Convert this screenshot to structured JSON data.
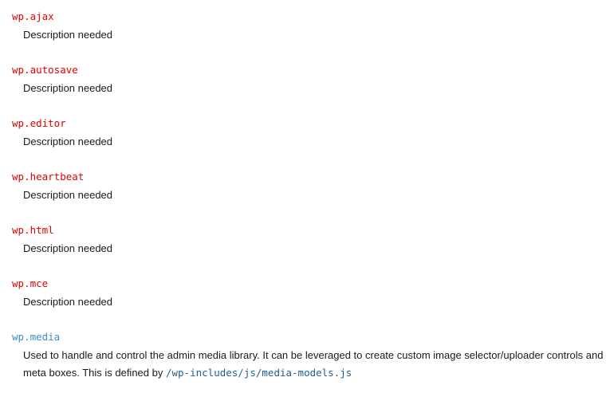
{
  "entries": [
    {
      "term": "wp.ajax",
      "description": "Description needed"
    },
    {
      "term": "wp.autosave",
      "description": "Description needed"
    },
    {
      "term": "wp.editor",
      "description": "Description needed"
    },
    {
      "term": "wp.heartbeat",
      "description": "Description needed"
    },
    {
      "term": "wp.html",
      "description": "Description needed"
    },
    {
      "term": "wp.mce",
      "description": "Description needed"
    },
    {
      "term": "wp.media",
      "description": "Used to handle and control the admin media library. It can be leveraged to create custom image selector/uploader controls and meta boxes. This is defined by",
      "path": "/wp-includes/js/media-models.js"
    }
  ],
  "colors": {
    "term_red": "#e00000",
    "term_link": "#3d8ec4",
    "code_path": "#1f5f8e"
  }
}
